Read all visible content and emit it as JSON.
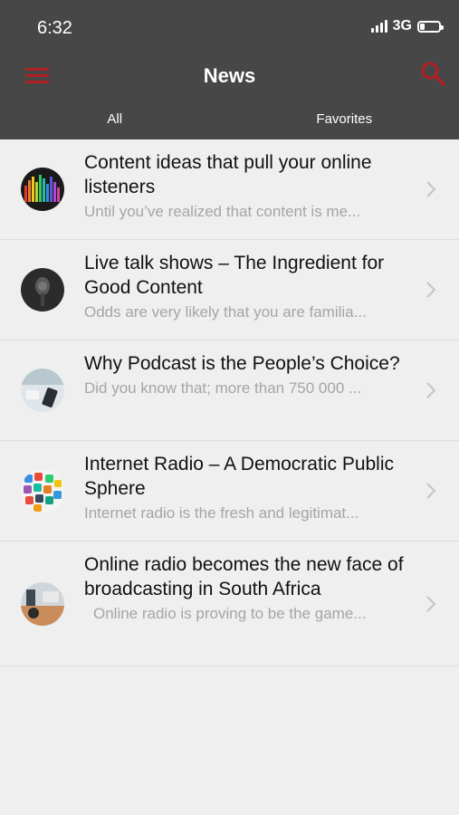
{
  "status_bar": {
    "time": "6:32",
    "network": "3G",
    "battery_level": 0.2
  },
  "nav": {
    "title": "News",
    "menu_icon": "hamburger-menu-icon",
    "search_icon": "search-icon",
    "accent_color": "#b21f24"
  },
  "tabs": [
    {
      "label": "All",
      "selected": true
    },
    {
      "label": "Favorites",
      "selected": false
    }
  ],
  "articles": [
    {
      "title": "Content ideas that pull your online listeners",
      "snippet": "Until you’ve realized that content is me..."
    },
    {
      "title": "Live talk shows – The Ingredient for Good Content",
      "snippet": "Odds are very likely that you are familia..."
    },
    {
      "title": "Why Podcast is the People’s Choice?",
      "snippet": "Did you know that; more than 750 000 ..."
    },
    {
      "title": "Internet Radio – A Democratic Public Sphere",
      "snippet": "Internet radio is the fresh and legitimat..."
    },
    {
      "title": "Online radio becomes the new face of broadcasting in South Africa",
      "snippet": "Online radio is proving to be the game..."
    }
  ]
}
